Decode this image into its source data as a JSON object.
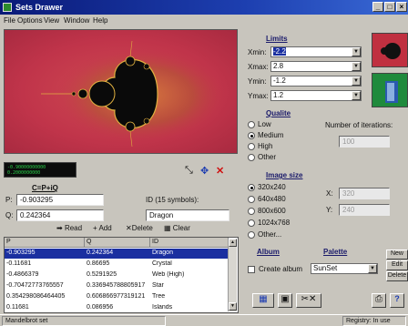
{
  "window": {
    "title": "Sets Drawer",
    "controls": [
      "_",
      "□",
      "×"
    ]
  },
  "menu": [
    "File",
    "Options",
    "View",
    "Window",
    "Help"
  ],
  "coords_readout": [
    "-0.90000000000",
    "0.2000000000"
  ],
  "formula": {
    "label": "C=P+iQ",
    "p_label": "P:",
    "p_value": "-0.903295",
    "q_label": "Q:",
    "q_value": "0.242364",
    "id_label": "ID (15 symbols):",
    "id_value": "Dragon"
  },
  "list_toolbar": {
    "read": "Read",
    "add": "Add",
    "delete": "Delete",
    "clear": "Clear"
  },
  "table": {
    "headers": [
      "P",
      "Q",
      "ID"
    ],
    "rows": [
      [
        "-0.903295",
        "0.242364",
        "Dragon"
      ],
      [
        "-0.11681",
        "0.86695",
        "Crystal"
      ],
      [
        "-0.4866379",
        "0.5291925",
        "Web (High)"
      ],
      [
        "-0.70472773765557",
        "0.336945788805917",
        "Star"
      ],
      [
        "0.354298086464405",
        "0.606866977319121",
        "Tree"
      ],
      [
        "0.11681",
        "0.086956",
        "Islands"
      ]
    ],
    "selected_row": 0
  },
  "limits": {
    "title": "Limits",
    "xmin_label": "Xmin:",
    "xmin": "-2.2",
    "xmax_label": "Xmax:",
    "xmax": "2.8",
    "ymin_label": "Ymin:",
    "ymin": "-1.2",
    "ymax_label": "Ymax:",
    "ymax": "1.2"
  },
  "quality": {
    "title": "Qualite",
    "options": [
      "Low",
      "Medium",
      "High",
      "Other"
    ],
    "selected": "Medium",
    "iterations_label": "Number of iterations:",
    "iterations_value": "100"
  },
  "image_size": {
    "title": "Image size",
    "options": [
      "320x240",
      "640x480",
      "800x600",
      "1024x768",
      "Other..."
    ],
    "selected": "320x240",
    "x_label": "X:",
    "x_value": "320",
    "y_label": "Y:",
    "y_value": "240"
  },
  "album": {
    "title": "Album",
    "create_label": "Create album",
    "create_checked": false
  },
  "palette": {
    "title": "Palette",
    "value": "SunSet"
  },
  "side_buttons": {
    "new": "New",
    "edit": "Edit",
    "delete": "Delete"
  },
  "statusbar": {
    "left": "Mandelbrot set",
    "right": "Registry: In use"
  },
  "colors": {
    "titlebar": "#0a1a78",
    "selection": "#1a2fa0",
    "fractal_bg": "#c0344a",
    "fractal_body": "#0a0a0a",
    "accent_text": "#1a1a6a"
  }
}
